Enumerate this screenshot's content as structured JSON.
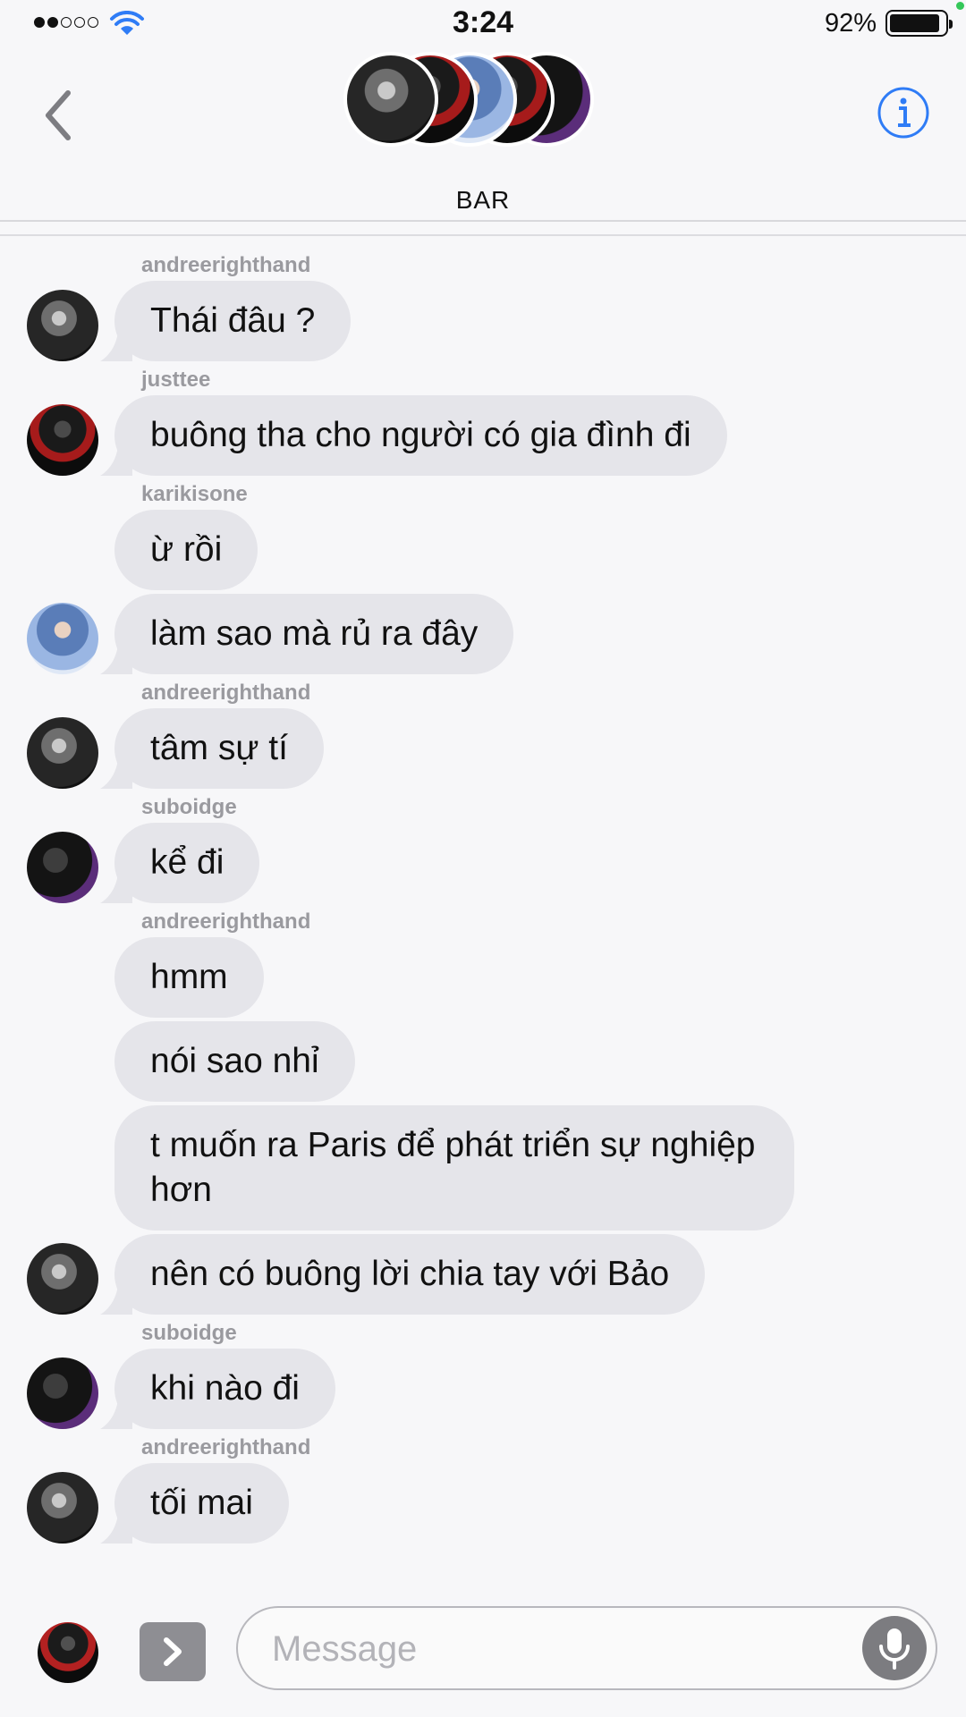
{
  "status_bar": {
    "time": "3:24",
    "battery_percent_label": "92%",
    "battery_level": 0.92,
    "signal_bars_filled": 2,
    "signal_bars_total": 5
  },
  "header": {
    "group_name": "BAR",
    "back_icon": "chevron-left-icon",
    "info_icon": "info-icon",
    "accent_color": "#2f7cf6"
  },
  "messages": [
    {
      "sender": "andreerighthand",
      "text": "Thái đâu ?",
      "avatar": "andree",
      "show_sender": true,
      "show_avatar": true
    },
    {
      "sender": "justtee",
      "text": "buông tha cho người có gia đình đi",
      "avatar": "justtee",
      "show_sender": true,
      "show_avatar": true
    },
    {
      "sender": "karikisone",
      "text": "ừ rồi",
      "avatar": "karik",
      "show_sender": true,
      "show_avatar": false
    },
    {
      "sender": "karikisone",
      "text": "làm sao mà rủ ra đây",
      "avatar": "karik",
      "show_sender": false,
      "show_avatar": true
    },
    {
      "sender": "andreerighthand",
      "text": "tâm sự tí",
      "avatar": "andree",
      "show_sender": true,
      "show_avatar": true
    },
    {
      "sender": "suboidge",
      "text": "kể đi",
      "avatar": "suboi",
      "show_sender": true,
      "show_avatar": true
    },
    {
      "sender": "andreerighthand",
      "text": "hmm",
      "avatar": "andree",
      "show_sender": true,
      "show_avatar": false
    },
    {
      "sender": "andreerighthand",
      "text": "nói sao nhỉ",
      "avatar": "andree",
      "show_sender": false,
      "show_avatar": false
    },
    {
      "sender": "andreerighthand",
      "text": "t muốn ra Paris để phát triển sự nghiệp hơn",
      "avatar": "andree",
      "show_sender": false,
      "show_avatar": false
    },
    {
      "sender": "andreerighthand",
      "text": "nên có buông lời chia tay với Bảo",
      "avatar": "andree",
      "show_sender": false,
      "show_avatar": true
    },
    {
      "sender": "suboidge",
      "text": "khi nào đi",
      "avatar": "suboi",
      "show_sender": true,
      "show_avatar": true
    },
    {
      "sender": "andreerighthand",
      "text": "tối mai",
      "avatar": "andree",
      "show_sender": true,
      "show_avatar": true
    }
  ],
  "input_bar": {
    "placeholder": "Message",
    "value": "",
    "expand_icon": "chevron-right-icon",
    "mic_icon": "microphone-icon"
  },
  "colors": {
    "bubble_bg": "#e5e5ea",
    "sender_text": "#9a9a9f",
    "background": "#f7f7f9"
  }
}
